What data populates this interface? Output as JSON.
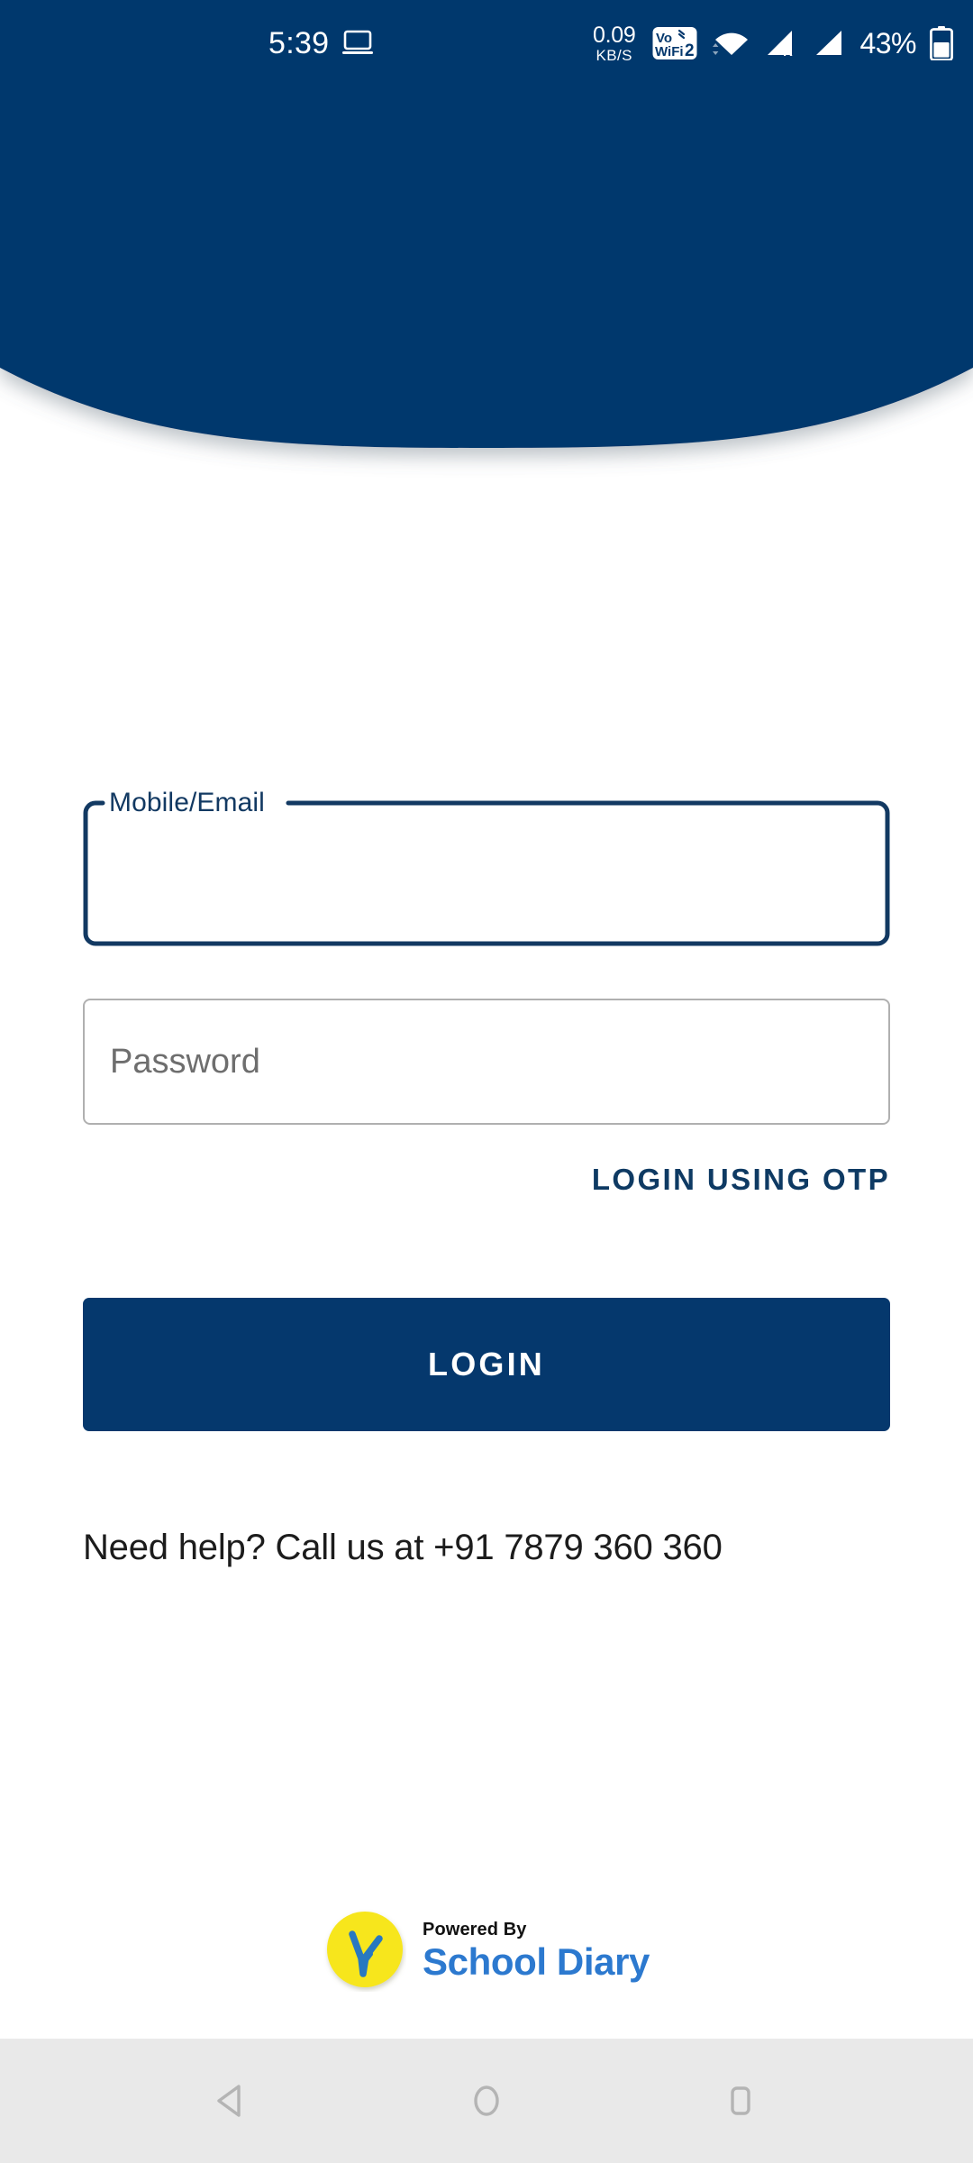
{
  "status_bar": {
    "clock": "5:39",
    "cast_icon": "laptop-icon",
    "network_speed_value": "0.09",
    "network_speed_unit": "KB/S",
    "vowifi_label": "VoWiFi",
    "vowifi_sim": "2",
    "wifi_icon": "wifi-icon",
    "signal1_icon": "signal-roaming-icon",
    "signal1_badge": "R",
    "signal2_icon": "signal-icon",
    "battery_percent": "43%",
    "battery_icon": "battery-icon"
  },
  "header": {
    "background_color": "#04386d"
  },
  "form": {
    "mobile_field": {
      "label": "Mobile/Email",
      "value": "",
      "placeholder": ""
    },
    "password_field": {
      "value": "",
      "placeholder": "Password"
    },
    "otp_link_label": "LOGIN USING OTP",
    "login_button_label": "LOGIN",
    "help_text": "Need help? Call us at +91 7879 360 360"
  },
  "footer": {
    "powered_by": "Powered By",
    "brand": "School Diary",
    "logo_icon": "school-diary-logo-icon",
    "logo_circle_color": "#f7e61c",
    "logo_glyph_color": "#2878c0",
    "brand_color": "#2c79cf"
  },
  "nav_bar": {
    "back_icon": "back-triangle-icon",
    "home_icon": "home-circle-icon",
    "recents_icon": "recents-square-icon"
  },
  "colors": {
    "primary_navy": "#04386d",
    "button_navy": "#05386d",
    "link_navy": "#0e3a63",
    "field_border_focus": "#123962",
    "field_border_idle": "#b0b0b0",
    "nav_bar_bg": "#e9e9e9"
  }
}
